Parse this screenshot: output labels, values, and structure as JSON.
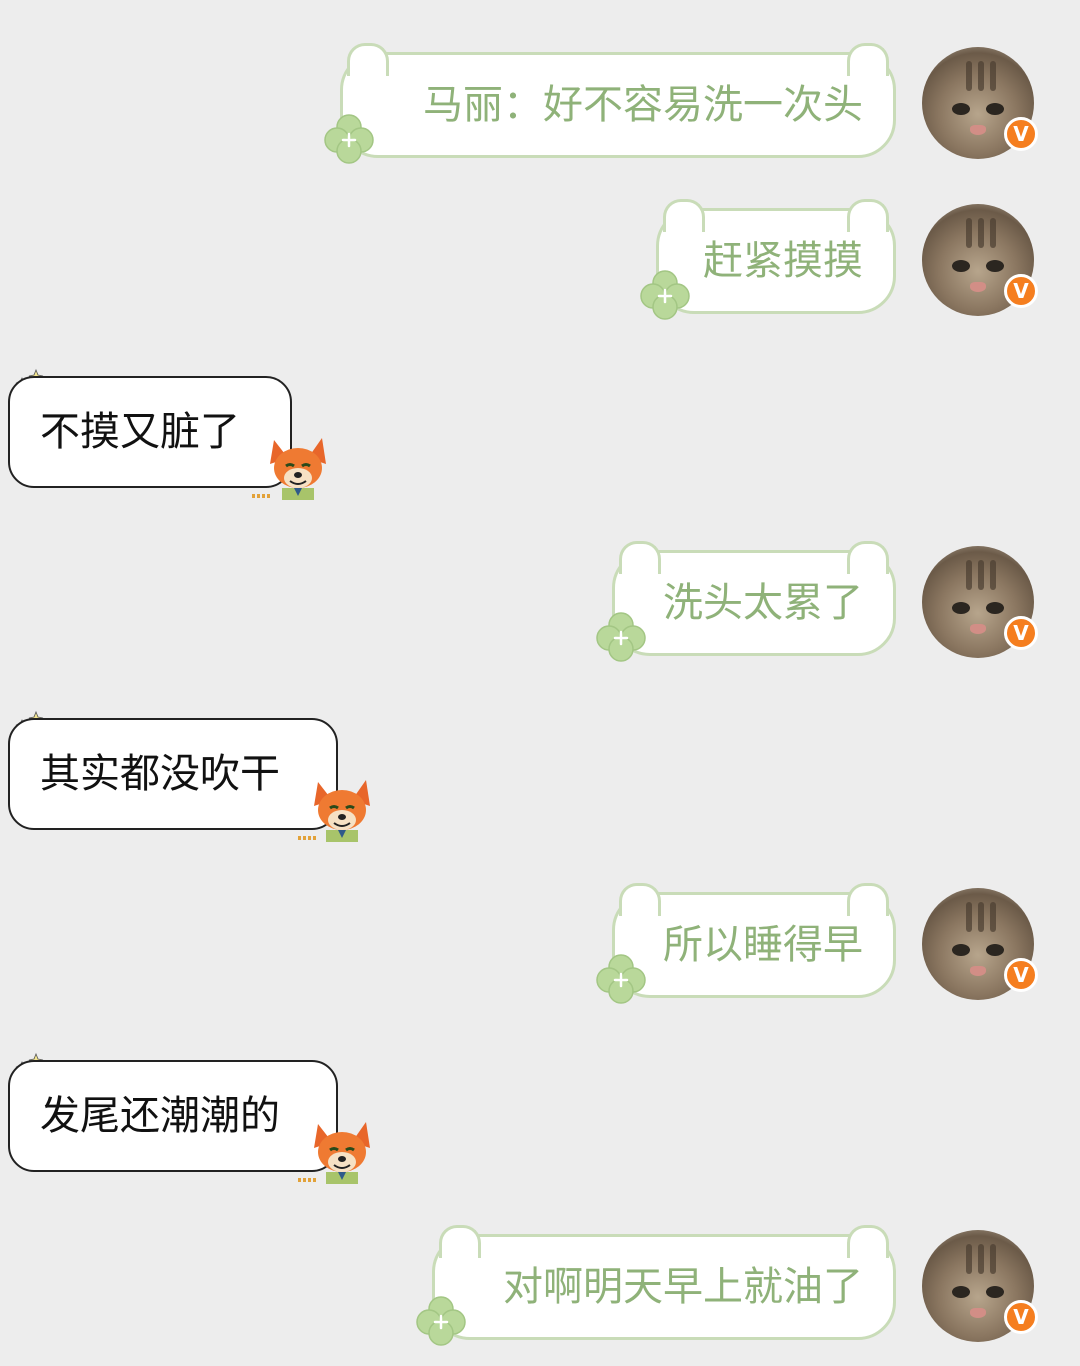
{
  "chat": {
    "messages": [
      {
        "side": "right",
        "text": "马丽：好不容易洗一次头",
        "avatar_badge": "V"
      },
      {
        "side": "right",
        "text": "赶紧摸摸",
        "avatar_badge": "V"
      },
      {
        "side": "left",
        "text": "不摸又脏了"
      },
      {
        "side": "right",
        "text": "洗头太累了",
        "avatar_badge": "V"
      },
      {
        "side": "left",
        "text": "其实都没吹干"
      },
      {
        "side": "right",
        "text": "所以睡得早",
        "avatar_badge": "V"
      },
      {
        "side": "left",
        "text": "发尾还潮潮的"
      },
      {
        "side": "right",
        "text": "对啊明天早上就油了",
        "avatar_badge": "V"
      }
    ]
  },
  "colors": {
    "background": "#ededed",
    "right_bubble_text": "#8fb279",
    "right_bubble_border": "#c9dcb8",
    "left_bubble_text": "#111111",
    "badge": "#f57e1f"
  },
  "icons": {
    "clover": "clover-icon",
    "fox": "fox-sticker-icon",
    "stars": "sparkle-stars-icon",
    "avatar": "cat-avatar",
    "badge": "verified-v-badge-icon"
  }
}
